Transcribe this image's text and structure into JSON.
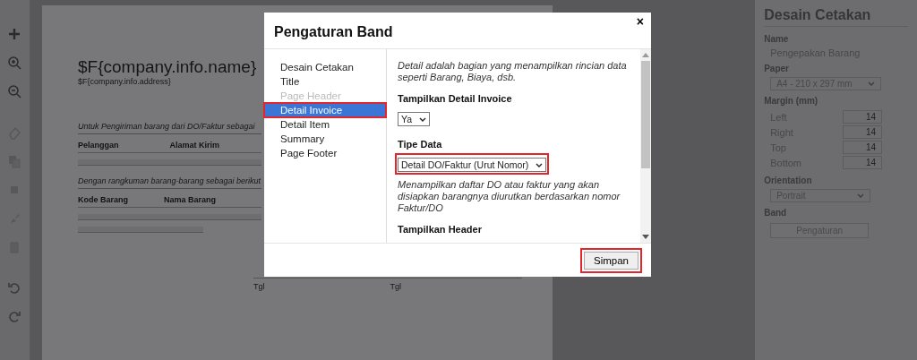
{
  "document": {
    "company_name": "$F{company.info.name}",
    "company_address": "$F{company.info.address}",
    "intro": "Untuk Pengiriman barang dari DO/Faktur sebagai",
    "customer_headers": [
      "Pelanggan",
      "Alamat Kirim"
    ],
    "items_intro": "Dengan rangkuman barang-barang sebagai berikut",
    "item_headers": [
      "Kode Barang",
      "Nama Barang"
    ],
    "signature_labels": [
      "Tgl",
      "Tgl"
    ]
  },
  "right_panel": {
    "title": "Desain Cetakan",
    "name_label": "Name",
    "name_value": "Pengepakan Barang",
    "paper_label": "Paper",
    "paper_value": "A4 - 210 x 297 mm",
    "margin_label": "Margin (mm)",
    "margins": [
      {
        "label": "Left",
        "value": "14"
      },
      {
        "label": "Right",
        "value": "14"
      },
      {
        "label": "Top",
        "value": "14"
      },
      {
        "label": "Bottom",
        "value": "14"
      }
    ],
    "orientation_label": "Orientation",
    "orientation_value": "Portrait",
    "band_label": "Band",
    "band_button": "Pengaturan"
  },
  "dialog": {
    "title": "Pengaturan Band",
    "close": "×",
    "nav": [
      {
        "label": "Desain Cetakan",
        "selected": false,
        "disabled": false,
        "highlighted": false
      },
      {
        "label": "Title",
        "selected": false,
        "disabled": false,
        "highlighted": false
      },
      {
        "label": "Page Header",
        "selected": false,
        "disabled": true,
        "highlighted": false
      },
      {
        "label": "Detail Invoice",
        "selected": true,
        "disabled": false,
        "highlighted": true
      },
      {
        "label": "Detail Item",
        "selected": false,
        "disabled": false,
        "highlighted": false
      },
      {
        "label": "Summary",
        "selected": false,
        "disabled": false,
        "highlighted": false
      },
      {
        "label": "Page Footer",
        "selected": false,
        "disabled": false,
        "highlighted": false
      }
    ],
    "description": "Detail adalah bagian yang menampilkan rincian data seperti Barang, Biaya, dsb.",
    "fields": [
      {
        "label": "Tampilkan Detail Invoice",
        "value": "Ya",
        "highlighted": false
      },
      {
        "label": "Tipe Data",
        "value": "Detail DO/Faktur (Urut Nomor)",
        "highlighted": true,
        "help": "Menampilkan daftar DO atau faktur yang akan disiapkan barangnya diurutkan berdasarkan nomor Faktur/DO"
      }
    ],
    "next_field_label": "Tampilkan Header",
    "save_button": {
      "label": "Simpan",
      "highlighted": true
    }
  }
}
